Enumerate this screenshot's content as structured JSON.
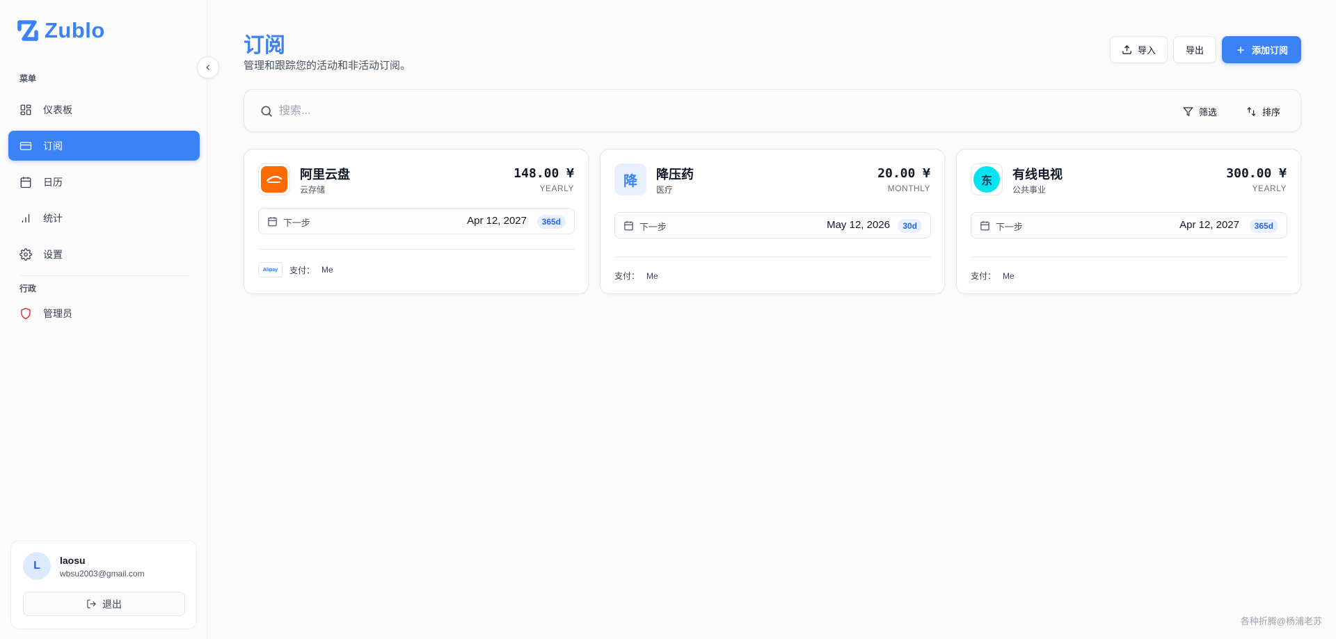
{
  "app": {
    "name": "Zublo",
    "brand_color": "#3b82f6"
  },
  "sidebar": {
    "menu_label": "菜单",
    "items": [
      {
        "label": "仪表板",
        "icon": "dashboard-icon"
      },
      {
        "label": "订阅",
        "icon": "credit-card-icon",
        "active": true
      },
      {
        "label": "日历",
        "icon": "calendar-icon"
      },
      {
        "label": "统计",
        "icon": "bar-chart-icon"
      },
      {
        "label": "设置",
        "icon": "gear-icon"
      }
    ],
    "admin_label": "行政",
    "admin_items": [
      {
        "label": "管理员",
        "icon": "shield-icon"
      }
    ]
  },
  "user": {
    "initial": "L",
    "name": "laosu",
    "email": "wbsu2003@gmail.com",
    "logout_label": "退出"
  },
  "header": {
    "title": "订阅",
    "subtitle": "管理和跟踪您的活动和非活动订阅。",
    "import_label": "导入",
    "export_label": "导出",
    "add_label": "添加订阅"
  },
  "search": {
    "placeholder": "搜索...",
    "filter_label": "筛选",
    "sort_label": "排序"
  },
  "subscriptions": [
    {
      "name": "阿里云盘",
      "category": "云存储",
      "price": "148.00 ¥",
      "cycle": "YEARLY",
      "next_label": "下一步",
      "next_date": "Apr 12, 2027",
      "days": "365d",
      "payment_method": "Alipay",
      "paid_by_label": "支付：",
      "paid_by": "Me",
      "logo_color": "#ff6a00"
    },
    {
      "name": "降压药",
      "category": "医疗",
      "price": "20.00 ¥",
      "cycle": "MONTHLY",
      "next_label": "下一步",
      "next_date": "May 12, 2026",
      "days": "30d",
      "logo_text": "降",
      "paid_by_label": "支付：",
      "paid_by": "Me"
    },
    {
      "name": "有线电视",
      "category": "公共事业",
      "price": "300.00 ¥",
      "cycle": "YEARLY",
      "next_label": "下一步",
      "next_date": "Apr 12, 2027",
      "days": "365d",
      "logo_text": "东",
      "paid_by_label": "支付：",
      "paid_by": "Me",
      "logo_color": "#00e5f0"
    }
  ],
  "watermark": "各种折腾@杨浦老苏"
}
